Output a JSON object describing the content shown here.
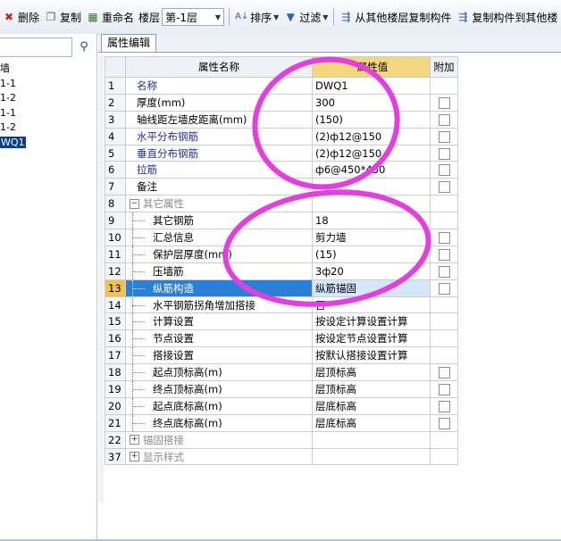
{
  "toolbar": {
    "delete": "删除",
    "copy": "复制",
    "rename": "重命名",
    "floor_label": "楼层",
    "floor_value": "第-1层",
    "sort": "排序",
    "filter": "过滤",
    "copy_from_other_floors": "从其他楼层复制构件",
    "copy_to_other_floors": "复制构件到其他楼"
  },
  "left_tree": {
    "items": [
      "墙",
      "1-1",
      "1-2",
      "1-1",
      "1-2",
      "WQ1"
    ],
    "selected_index": 5
  },
  "tab": {
    "label": "属性编辑"
  },
  "grid": {
    "headers": {
      "name": "属性名称",
      "value": "属性值",
      "add": "附加"
    },
    "rows": [
      {
        "num": "1",
        "name": "名称",
        "value": "DWQ1",
        "style": "blue",
        "checkbox": false,
        "indent": "top"
      },
      {
        "num": "2",
        "name": "厚度(mm)",
        "value": "300",
        "style": "normal",
        "checkbox": true,
        "indent": "top"
      },
      {
        "num": "3",
        "name": "轴线距左墙皮距离(mm)",
        "value": "(150)",
        "style": "normal",
        "checkbox": true,
        "indent": "top"
      },
      {
        "num": "4",
        "name": "水平分布钢筋",
        "value": "(2)ф12@150",
        "style": "blue",
        "checkbox": true,
        "indent": "top"
      },
      {
        "num": "5",
        "name": "垂直分布钢筋",
        "value": "(2)ф12@150",
        "style": "blue",
        "checkbox": true,
        "indent": "top"
      },
      {
        "num": "6",
        "name": "拉筋",
        "value": "ф6@450*450",
        "style": "blue",
        "checkbox": true,
        "indent": "top"
      },
      {
        "num": "7",
        "name": "备注",
        "value": "",
        "style": "normal",
        "checkbox": true,
        "indent": "top"
      },
      {
        "num": "8",
        "name": "其它属性",
        "value": "",
        "style": "grey",
        "checkbox": false,
        "indent": "group",
        "expander": "−"
      },
      {
        "num": "9",
        "name": "其它钢筋",
        "value": "18",
        "style": "normal",
        "checkbox": false,
        "indent": "child"
      },
      {
        "num": "10",
        "name": "汇总信息",
        "value": "剪力墙",
        "style": "normal",
        "checkbox": true,
        "indent": "child"
      },
      {
        "num": "11",
        "name": "保护层厚度(mm)",
        "value": "(15)",
        "style": "normal",
        "checkbox": true,
        "indent": "child"
      },
      {
        "num": "12",
        "name": "压墙筋",
        "value": "3ф20",
        "style": "normal",
        "checkbox": true,
        "indent": "child"
      },
      {
        "num": "13",
        "name": "纵筋构造",
        "value": "纵筋锚固",
        "style": "normal",
        "checkbox": true,
        "indent": "child",
        "selected": true
      },
      {
        "num": "14",
        "name": "水平钢筋拐角增加搭接",
        "value": "否",
        "style": "normal",
        "checkbox": false,
        "indent": "child"
      },
      {
        "num": "15",
        "name": "计算设置",
        "value": "按设定计算设置计算",
        "style": "normal",
        "checkbox": false,
        "indent": "child"
      },
      {
        "num": "16",
        "name": "节点设置",
        "value": "按设定节点设置计算",
        "style": "normal",
        "checkbox": false,
        "indent": "child"
      },
      {
        "num": "17",
        "name": "搭接设置",
        "value": "按默认搭接设置计算",
        "style": "normal",
        "checkbox": false,
        "indent": "child"
      },
      {
        "num": "18",
        "name": "起点顶标高(m)",
        "value": "层顶标高",
        "style": "normal",
        "checkbox": true,
        "indent": "child"
      },
      {
        "num": "19",
        "name": "终点顶标高(m)",
        "value": "层顶标高",
        "style": "normal",
        "checkbox": true,
        "indent": "child"
      },
      {
        "num": "20",
        "name": "起点底标高(m)",
        "value": "层底标高",
        "style": "normal",
        "checkbox": true,
        "indent": "child"
      },
      {
        "num": "21",
        "name": "终点底标高(m)",
        "value": "层底标高",
        "style": "normal",
        "checkbox": true,
        "indent": "child"
      },
      {
        "num": "22",
        "name": "锚固搭接",
        "value": "",
        "style": "grey",
        "checkbox": false,
        "indent": "group",
        "expander": "+"
      },
      {
        "num": "37",
        "name": "显示样式",
        "value": "",
        "style": "grey",
        "checkbox": false,
        "indent": "group",
        "expander": "+"
      }
    ]
  },
  "colors": {
    "annotation_stroke": "#e43ee0",
    "selected_row": "#2a7fd6",
    "value_header": "#f3d77c",
    "blue_text": "#1f2fa6"
  }
}
